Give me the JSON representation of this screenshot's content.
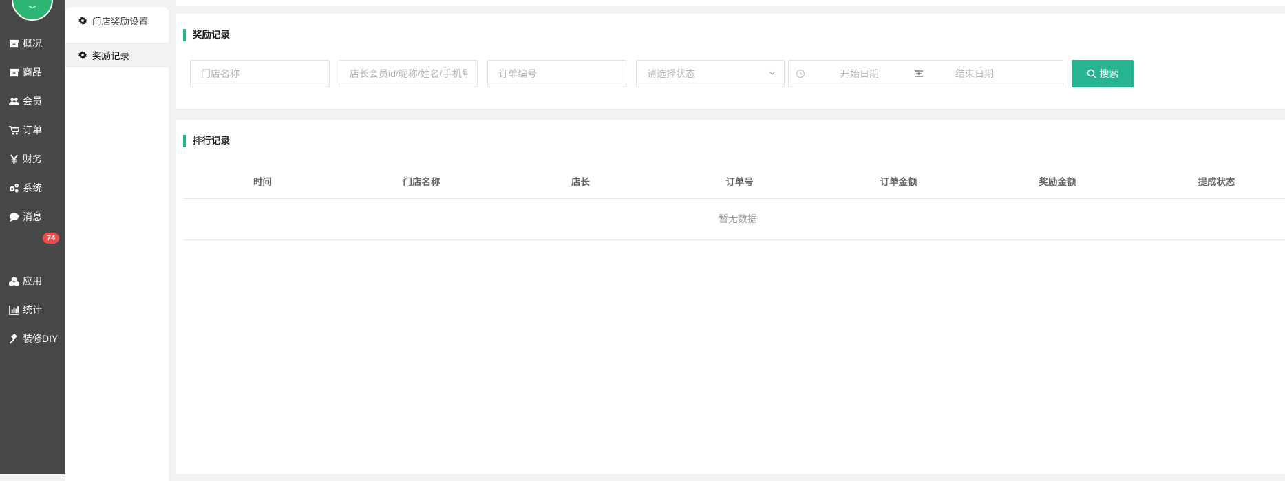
{
  "nav": {
    "items": [
      {
        "label": "概况",
        "icon": "archive-icon"
      },
      {
        "label": "商品",
        "icon": "archive-icon"
      },
      {
        "label": "会员",
        "icon": "users-icon"
      },
      {
        "label": "订单",
        "icon": "cart-icon"
      },
      {
        "label": "财务",
        "icon": "yen-icon"
      },
      {
        "label": "系统",
        "icon": "gears-icon"
      },
      {
        "label": "消息",
        "icon": "comment-icon"
      },
      {
        "label": "应用",
        "icon": "cubes-icon"
      },
      {
        "label": "统计",
        "icon": "bar-chart-icon"
      },
      {
        "label": "装修DIY",
        "icon": "gavel-icon"
      }
    ],
    "message_badge": "74"
  },
  "subnav": {
    "items": [
      {
        "label": "门店奖励设置",
        "active": false
      },
      {
        "label": "奖励记录",
        "active": true
      }
    ]
  },
  "search_section": {
    "title": "奖励记录",
    "store_name_placeholder": "门店名称",
    "manager_placeholder": "店长会员id/昵称/姓名/手机号",
    "order_no_placeholder": "订单编号",
    "status_placeholder": "请选择状态",
    "start_date_placeholder": "开始日期",
    "end_date_placeholder": "结束日期",
    "search_button": "搜索"
  },
  "list_section": {
    "title": "排行记录",
    "columns": [
      "时间",
      "门店名称",
      "店长",
      "订单号",
      "订单金额",
      "奖励金额",
      "提成状态"
    ],
    "empty_text": "暂无数据"
  },
  "colors": {
    "accent": "#26b492",
    "nav_bg": "#484848",
    "badge": "#f04b4b"
  }
}
